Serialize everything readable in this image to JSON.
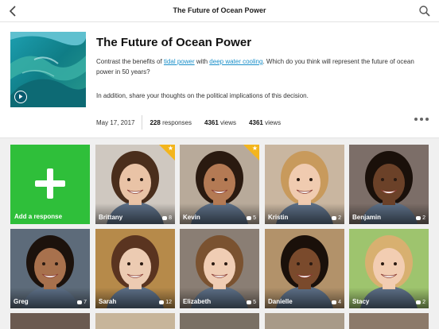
{
  "topbar": {
    "title": "The Future of Ocean Power"
  },
  "header": {
    "headline": "The Future of Ocean Power",
    "prompt_pre": "Contrast the benefits of ",
    "link1": "tidal power",
    "prompt_mid": " with ",
    "link2": "deep water cooling",
    "prompt_post": ". Which do you think will represent the future of ocean power in 50 years?",
    "prompt2": "In addition, share your thoughts on the political implications of this decision.",
    "date": "May 17, 2017",
    "responses_count": "228",
    "responses_label": "responses",
    "views1_count": "4361",
    "views1_label": "views",
    "views2_count": "4361",
    "views2_label": "views"
  },
  "grid": {
    "add_label": "Add a response",
    "tiles": [
      {
        "name": "Brittany",
        "count": "8",
        "starred": true,
        "bg": "#cfc8c0",
        "skin": "#e9c3a6",
        "hair": "#4a2e1c"
      },
      {
        "name": "Kevin",
        "count": "5",
        "starred": true,
        "bg": "#b8aa9a",
        "skin": "#b47a54",
        "hair": "#2a1a10"
      },
      {
        "name": "Kristin",
        "count": "2",
        "starred": false,
        "bg": "#c9b6a0",
        "skin": "#f0cbb0",
        "hair": "#c89a5c"
      },
      {
        "name": "Benjamin",
        "count": "2",
        "starred": false,
        "bg": "#7c6e68",
        "skin": "#6b4128",
        "hair": "#1a100a"
      },
      {
        "name": "Greg",
        "count": "7",
        "starred": false,
        "bg": "#5d6b7a",
        "skin": "#a8714d",
        "hair": "#1c120c"
      },
      {
        "name": "Sarah",
        "count": "12",
        "starred": false,
        "bg": "#b68a4a",
        "skin": "#eccbb2",
        "hair": "#5a3420"
      },
      {
        "name": "Elizabeth",
        "count": "5",
        "starred": false,
        "bg": "#8a7e74",
        "skin": "#f0cdb4",
        "hair": "#7a5230"
      },
      {
        "name": "Danielle",
        "count": "4",
        "starred": false,
        "bg": "#b2926a",
        "skin": "#7a4a2c",
        "hair": "#1a100a"
      },
      {
        "name": "Stacy",
        "count": "2",
        "starred": false,
        "bg": "#9ec46e",
        "skin": "#f2cdb2",
        "hair": "#d8b070"
      }
    ]
  }
}
